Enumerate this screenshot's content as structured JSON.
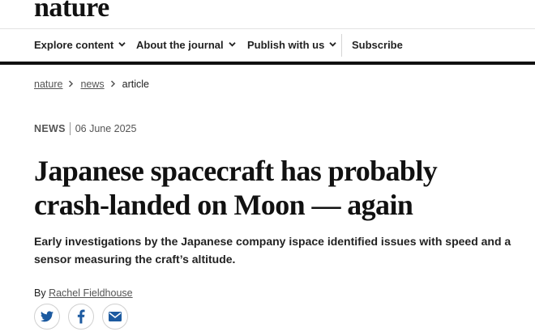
{
  "brand": {
    "name": "nature"
  },
  "nav": {
    "items": [
      {
        "label": "Explore content",
        "has_dropdown": true
      },
      {
        "label": "About the journal",
        "has_dropdown": true
      },
      {
        "label": "Publish with us",
        "has_dropdown": true
      },
      {
        "label": "Subscribe",
        "has_dropdown": false
      }
    ]
  },
  "breadcrumb": {
    "items": [
      "nature",
      "news"
    ],
    "current": "article"
  },
  "article": {
    "type": "NEWS",
    "date": "06 June 2025",
    "title": "Japanese spacecraft has probably crash-landed on Moon — again",
    "standfirst": "Early investigations by the Japanese company ispace identified issues with speed and a sensor measuring the craft’s altitude.",
    "byline_prefix": "By",
    "author": "Rachel Fieldhouse"
  },
  "share": {
    "icons": [
      "twitter-icon",
      "facebook-icon",
      "email-icon"
    ]
  },
  "colors": {
    "text": "#222222",
    "muted": "#555555",
    "rule": "#111111",
    "share_icon": "#1c5aa0"
  }
}
